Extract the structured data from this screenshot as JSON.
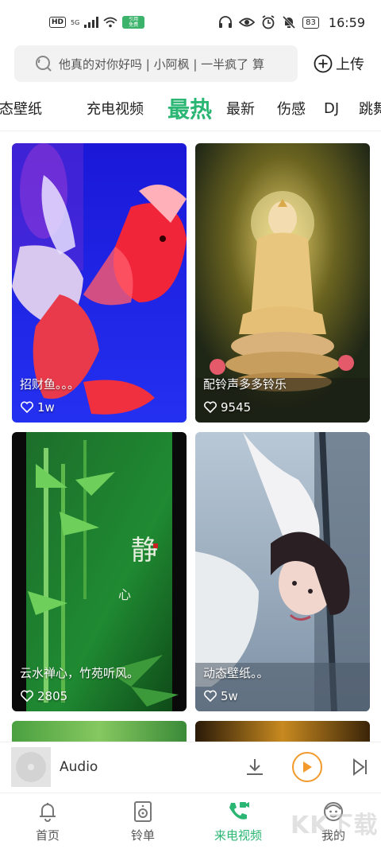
{
  "status_bar": {
    "hd": "HD",
    "network": "5G",
    "wechat_badge_top": "引用",
    "wechat_badge_bottom": "免费",
    "battery": "83",
    "time": "16:59"
  },
  "search": {
    "placeholder": "他真的对你好吗 | 小阿枫 | 一半疯了 算",
    "upload_label": "上传"
  },
  "tabs": [
    {
      "label": "态壁纸",
      "active": false
    },
    {
      "label": "充电视频",
      "active": false
    },
    {
      "label": "最热",
      "active": true
    },
    {
      "label": "最新",
      "active": false
    },
    {
      "label": "伤感",
      "active": false
    },
    {
      "label": "DJ",
      "active": false
    },
    {
      "label": "跳舞",
      "active": false
    }
  ],
  "videos": [
    {
      "title": "招财鱼。。。",
      "likes": "1w"
    },
    {
      "title": "配铃声多多铃乐",
      "likes": "9545"
    },
    {
      "title": "云水禅心，竹苑听风。",
      "likes": "2805"
    },
    {
      "title": "动态壁纸。。",
      "likes": "5w"
    }
  ],
  "player": {
    "label": "Audio"
  },
  "bottom_nav": [
    {
      "label": "首页",
      "icon": "bell-icon",
      "active": false
    },
    {
      "label": "铃单",
      "icon": "speaker-icon",
      "active": false
    },
    {
      "label": "来电视频",
      "icon": "phone-video-icon",
      "active": true
    },
    {
      "label": "我的",
      "icon": "profile-icon",
      "active": false
    }
  ],
  "watermark": "KK下载",
  "colors": {
    "accent": "#2bb673",
    "play": "#f39a2c"
  }
}
